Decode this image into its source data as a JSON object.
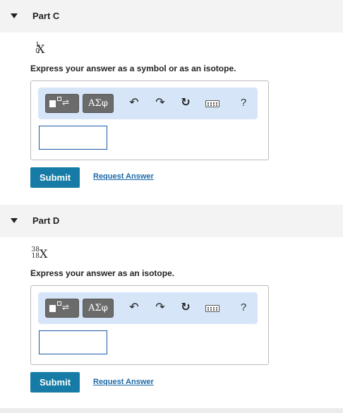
{
  "parts": [
    {
      "title": "Part C",
      "formula": {
        "mass": "1",
        "atomic": "0",
        "symbol": "X"
      },
      "instruction": "Express your answer as a symbol or as an isotope.",
      "toolbar": {
        "greek_label": "ΑΣφ",
        "help_label": "?"
      },
      "input_value": "",
      "submit_label": "Submit",
      "request_label": "Request Answer"
    },
    {
      "title": "Part D",
      "formula": {
        "mass": "38",
        "atomic": "18",
        "symbol": "X"
      },
      "instruction": "Express your answer as an isotope.",
      "toolbar": {
        "greek_label": "ΑΣφ",
        "help_label": "?"
      },
      "input_value": "",
      "submit_label": "Submit",
      "request_label": "Request Answer"
    }
  ],
  "icons": {
    "caret": "caret-down-icon",
    "templates": "templates-icon",
    "undo": "undo-icon",
    "redo": "redo-icon",
    "reset": "reset-icon",
    "keyboard": "keyboard-icon"
  },
  "colors": {
    "accent": "#167ba6",
    "link": "#1c6aa8",
    "toolbar_bg": "#d6e6f8",
    "header_bg": "#f3f3f3",
    "input_border": "#1a5aa8"
  }
}
